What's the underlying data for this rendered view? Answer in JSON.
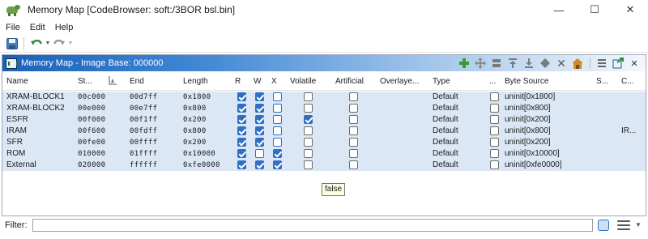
{
  "window": {
    "title": "Memory Map [CodeBrowser: soft:/3BOR bsl.bin]",
    "controls": {
      "minimize": "—",
      "maximize": "☐",
      "close": "✕"
    }
  },
  "menubar": {
    "items": [
      "File",
      "Edit",
      "Help"
    ]
  },
  "panel": {
    "title": "Memory Map - Image Base: 000000"
  },
  "table": {
    "columns": [
      "Name",
      "St...",
      "End",
      "Length",
      "R",
      "W",
      "X",
      "Volatile",
      "Artificial",
      "Overlaye...",
      "Type",
      "...",
      "Byte Source",
      "S...",
      "C..."
    ],
    "rows": [
      {
        "name": "XRAM-BLOCK1",
        "start": "00c000",
        "end": "00d7ff",
        "length": "0x1800",
        "r": true,
        "w": true,
        "x": false,
        "volatile": false,
        "artificial": false,
        "type": "Default",
        "init": false,
        "byte_source": "uninit[0x1800]",
        "comment": ""
      },
      {
        "name": "XRAM-BLOCK2",
        "start": "00e000",
        "end": "00e7ff",
        "length": "0x800",
        "r": true,
        "w": true,
        "x": false,
        "volatile": false,
        "artificial": false,
        "type": "Default",
        "init": false,
        "byte_source": "uninit[0x800]",
        "comment": ""
      },
      {
        "name": "ESFR",
        "start": "00f000",
        "end": "00f1ff",
        "length": "0x200",
        "r": true,
        "w": true,
        "x": false,
        "volatile": true,
        "artificial": false,
        "type": "Default",
        "init": false,
        "byte_source": "uninit[0x200]",
        "comment": ""
      },
      {
        "name": "IRAM",
        "start": "00f600",
        "end": "00fdff",
        "length": "0x800",
        "r": true,
        "w": true,
        "x": false,
        "volatile": false,
        "artificial": false,
        "type": "Default",
        "init": false,
        "byte_source": "uninit[0x800]",
        "comment": "IR..."
      },
      {
        "name": "SFR",
        "start": "00fe00",
        "end": "00ffff",
        "length": "0x200",
        "r": true,
        "w": true,
        "x": false,
        "volatile": false,
        "artificial": false,
        "type": "Default",
        "init": false,
        "byte_source": "uninit[0x200]",
        "comment": ""
      },
      {
        "name": "ROM",
        "start": "010000",
        "end": "01ffff",
        "length": "0x10000",
        "r": true,
        "w": false,
        "x": true,
        "volatile": false,
        "artificial": false,
        "type": "Default",
        "init": false,
        "byte_source": "uninit[0x10000]",
        "comment": ""
      },
      {
        "name": "External",
        "start": "020000",
        "end": "ffffff",
        "length": "0xfe0000",
        "r": true,
        "w": true,
        "x": true,
        "volatile": false,
        "artificial": false,
        "type": "Default",
        "init": false,
        "byte_source": "uninit[0xfe0000]",
        "comment": ""
      }
    ]
  },
  "tooltip": {
    "text": "false"
  },
  "filter": {
    "label": "Filter:",
    "value": ""
  },
  "colors": {
    "accent": "#2f6fc4",
    "selection": "#dce7f5",
    "header_start": "#1a62b8",
    "add_icon": "#3a9a2a",
    "remove_icon": "#5a5a5a"
  }
}
